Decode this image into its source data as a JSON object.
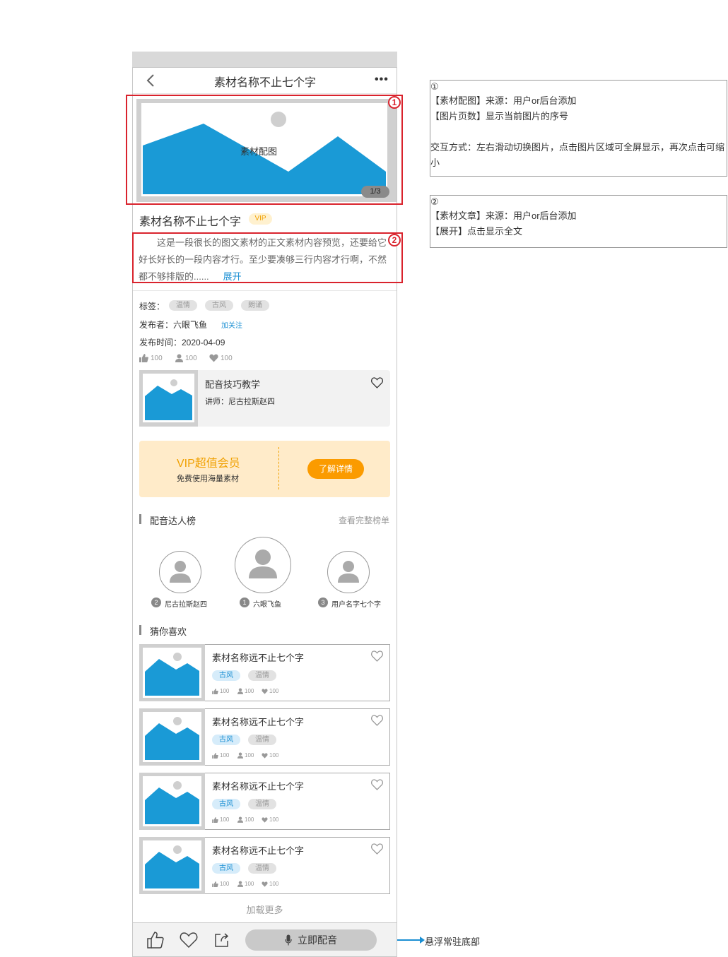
{
  "header": {
    "title": "素材名称不止七个字",
    "back_icon": "chevron-left-icon",
    "more_icon": "more-dots-icon",
    "more_text": "•••"
  },
  "gallery": {
    "caption": "素材配图",
    "page_indicator": "1/3",
    "annotation_number": "1"
  },
  "material": {
    "title": "素材名称不止七个字",
    "vip_badge": "VIP",
    "article_text": "这是一段很长的图文素材的正文素材内容预览，还要给它好长好长的一段内容才行。至少要凑够三行内容才行啊，不然都不够排版的......",
    "expand_label": "展开",
    "annotation_number": "2"
  },
  "meta": {
    "tags_label": "标签：",
    "tags": [
      "温情",
      "古风",
      "朗诵"
    ],
    "publisher_label": "发布者：六眼飞鱼",
    "follow_label": "加关注",
    "date_label": "发布时间：2020-04-09",
    "stats": {
      "likes": "100",
      "users": "100",
      "favorites": "100"
    }
  },
  "course": {
    "title": "配音技巧教学",
    "lecturer": "讲师：尼古拉斯赵四"
  },
  "vip_promo": {
    "title": "VIP超值会员",
    "subtitle": "免费使用海量素材",
    "button": "了解详情",
    "accent_color": "#fb9b00"
  },
  "ranking": {
    "title": "配音达人榜",
    "link": "查看完整榜单",
    "users": [
      {
        "rank": "2",
        "name": "尼古拉斯赵四"
      },
      {
        "rank": "1",
        "name": "六眼飞鱼"
      },
      {
        "rank": "3",
        "name": "用户名字七个字"
      }
    ]
  },
  "recommend": {
    "title": "猜你喜欢",
    "items": [
      {
        "title": "素材名称远不止七个字",
        "tag1": "古风",
        "tag2": "温情",
        "likes": "100",
        "users": "100",
        "favorites": "100"
      },
      {
        "title": "素材名称远不止七个字",
        "tag1": "古风",
        "tag2": "温情",
        "likes": "100",
        "users": "100",
        "favorites": "100"
      },
      {
        "title": "素材名称远不止七个字",
        "tag1": "古风",
        "tag2": "温情",
        "likes": "100",
        "users": "100",
        "favorites": "100"
      },
      {
        "title": "素材名称远不止七个字",
        "tag1": "古风",
        "tag2": "温情",
        "likes": "100",
        "users": "100",
        "favorites": "100"
      }
    ],
    "load_more": "加载更多"
  },
  "bottom_bar": {
    "dub_button": "立即配音",
    "float_note": "悬浮常驻底部"
  },
  "notes": {
    "note1": {
      "number": "①",
      "line1": "【素材配图】来源：用户or后台添加",
      "line2": "【图片页数】显示当前图片的序号",
      "line3": "交互方式：左右滑动切换图片，点击图片区域可全屏显示，再次点击可缩小"
    },
    "note2": {
      "number": "②",
      "line1": "【素材文章】来源：用户or后台添加",
      "line2": "【展开】点击显示全文"
    }
  },
  "colors": {
    "image_blue": "#1a9ad6",
    "link_blue": "#1a8fd3",
    "annotation_red": "#d9232d",
    "vip_bg": "#ffebc9"
  }
}
